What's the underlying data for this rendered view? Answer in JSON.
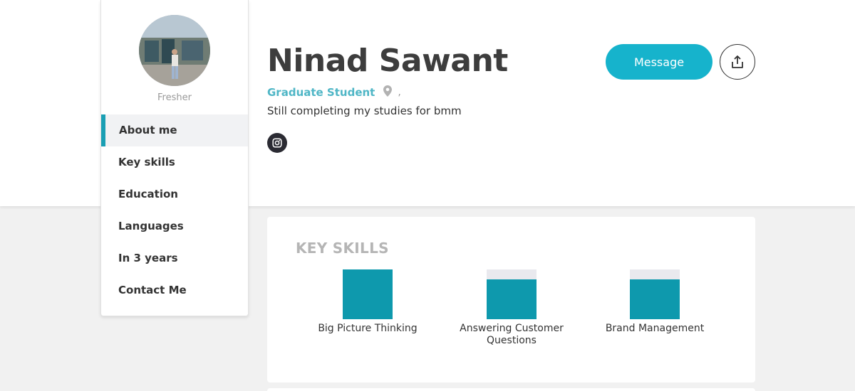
{
  "profile": {
    "name": "Ninad Sawant",
    "job_title": "Graduate Student",
    "location": ",",
    "bio": "Still completing my studies for bmm",
    "role_tag": "Fresher"
  },
  "sidebar": {
    "items": [
      {
        "label": "About me",
        "active": true
      },
      {
        "label": "Key skills",
        "active": false
      },
      {
        "label": "Education",
        "active": false
      },
      {
        "label": "Languages",
        "active": false
      },
      {
        "label": "In 3 years",
        "active": false
      },
      {
        "label": "Contact Me",
        "active": false
      }
    ]
  },
  "actions": {
    "message_label": "Message",
    "share_icon": "share-icon",
    "social_icon": "instagram-icon"
  },
  "key_skills": {
    "title": "KEY SKILLS",
    "skills": [
      {
        "label": "Big Picture Thinking",
        "level": 1.0
      },
      {
        "label": "Answering Customer Questions",
        "level": 0.8
      },
      {
        "label": "Brand Management",
        "level": 0.8
      }
    ]
  },
  "colors": {
    "accent": "#16b3cc",
    "skill_fill": "#0e99ad",
    "job_title": "#4fb6c6",
    "active_border": "#1a9fb4"
  }
}
